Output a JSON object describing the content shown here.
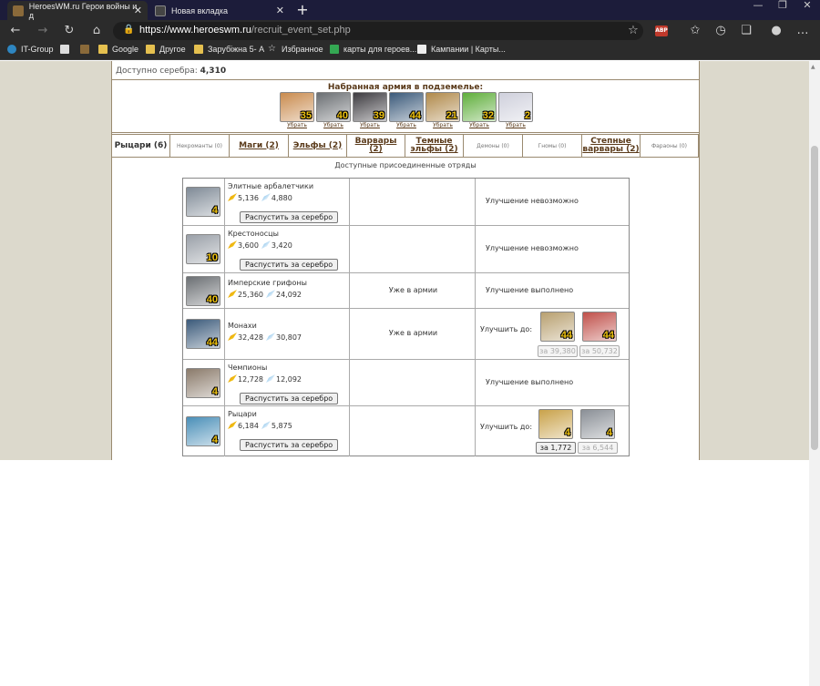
{
  "browser": {
    "tabs": [
      {
        "title": "HeroesWM.ru Герои войны и д",
        "active": true
      },
      {
        "title": "Новая вкладка",
        "active": false
      }
    ],
    "url_main": "https://www.heroeswm.ru",
    "url_path": "/recruit_event_set.php",
    "bookmarks": [
      "IT-Group",
      "Google",
      "Другое",
      "Зарубіжна 5- А",
      "Избранное",
      "карты для героев...",
      "Кампании | Карты..."
    ]
  },
  "page": {
    "silver_label": "Доступно серебра:",
    "silver_value": "4,310",
    "army_title": "Набранная армия в подземелье:",
    "remove_label": "Убрать",
    "army": [
      {
        "count": "35",
        "color": "#c98b4e"
      },
      {
        "count": "40",
        "color": "#6b6f73"
      },
      {
        "count": "39",
        "color": "#3d3b40"
      },
      {
        "count": "44",
        "color": "#3b5a7a"
      },
      {
        "count": "21",
        "color": "#b0894a"
      },
      {
        "count": "32",
        "color": "#5fae3b"
      },
      {
        "count": "2",
        "color": "#cfd0dc"
      }
    ],
    "factions": [
      {
        "label": "Рыцари (6)",
        "style": "cur"
      },
      {
        "label": "Некроманты (0)",
        "style": "small"
      },
      {
        "label": "Маги (2)",
        "style": "bold"
      },
      {
        "label": "Эльфы (2)",
        "style": "bold"
      },
      {
        "label": "Варвары (2)",
        "style": "bold"
      },
      {
        "label": "Темные эльфы (2)",
        "style": "bold"
      },
      {
        "label": "Демоны (0)",
        "style": "small"
      },
      {
        "label": "Гномы (0)",
        "style": "small"
      },
      {
        "label": "Степные варвары (2)",
        "style": "bold"
      },
      {
        "label": "Фараоны (0)",
        "style": "small"
      }
    ],
    "available_title": "Доступные присоединенные отряды",
    "release_button": "Распустить за серебро",
    "upgrade_to": "Улучшить до:",
    "troops": [
      {
        "name": "Элитные арбалетчики",
        "count": "4",
        "gold": "5,136",
        "silver": "4,880",
        "middle": "",
        "status": "Улучшение невозможно",
        "release": true,
        "color": "#7f8a96"
      },
      {
        "name": "Крестоносцы",
        "count": "10",
        "gold": "3,600",
        "silver": "3,420",
        "middle": "",
        "status": "Улучшение невозможно",
        "release": true,
        "color": "#9aa0a8"
      },
      {
        "name": "Имперские грифоны",
        "count": "40",
        "gold": "25,360",
        "silver": "24,092",
        "middle": "Уже в армии",
        "status": "Улучшение выполнено",
        "release": false,
        "color": "#6b6f73"
      },
      {
        "name": "Монахи",
        "count": "44",
        "gold": "32,428",
        "silver": "30,807",
        "middle": "Уже в армии",
        "status": "",
        "release": false,
        "color": "#3b5a7a",
        "upgrades": [
          {
            "count": "44",
            "price": "за 39,380",
            "enabled": false,
            "color": "#b8a070"
          },
          {
            "count": "44",
            "price": "за 50,732",
            "enabled": false,
            "color": "#c0504a"
          }
        ]
      },
      {
        "name": "Чемпионы",
        "count": "4",
        "gold": "12,728",
        "silver": "12,092",
        "middle": "",
        "status": "Улучшение выполнено",
        "release": true,
        "color": "#8a7a6a"
      },
      {
        "name": "Рыцари",
        "count": "4",
        "gold": "6,184",
        "silver": "5,875",
        "middle": "",
        "status": "",
        "release": true,
        "color": "#4a8fb8",
        "upgrades": [
          {
            "count": "4",
            "price": "за 1,772",
            "enabled": true,
            "color": "#c9a24a"
          },
          {
            "count": "4",
            "price": "за 6,544",
            "enabled": false,
            "color": "#8a8f96"
          }
        ]
      }
    ]
  }
}
